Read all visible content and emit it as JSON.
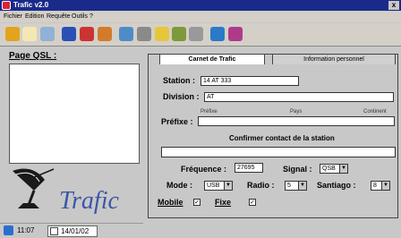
{
  "window": {
    "title": "Trafic v2.0",
    "close_glyph": "x"
  },
  "menu": [
    "Fichier",
    "Edition",
    "Requête",
    "Outils",
    "?"
  ],
  "toolbar": {
    "icons": [
      {
        "name": "pencil-icon",
        "color": "#e2a31d"
      },
      {
        "name": "open-book-icon",
        "color": "#f3e7b5"
      },
      {
        "name": "save-book-icon",
        "color": "#8fb2d6"
      },
      {
        "name": "blue-book-icon",
        "color": "#2a4fb7"
      },
      {
        "name": "book-red-icon",
        "color": "#c33"
      },
      {
        "name": "edit-document-icon",
        "color": "#d47b2a"
      },
      {
        "name": "search-icon",
        "color": "#4f8bc8"
      },
      {
        "name": "printer-icon",
        "color": "#8a8a8a"
      },
      {
        "name": "star-icon",
        "color": "#e8c63b"
      },
      {
        "name": "gear-icon",
        "color": "#7d9a3b"
      },
      {
        "name": "tools-icon",
        "color": "#999"
      },
      {
        "name": "globe-icon",
        "color": "#2a7ac8"
      },
      {
        "name": "satellite-icon",
        "color": "#b03a8a"
      }
    ]
  },
  "left": {
    "qsl_label": "Page QSL :",
    "logo_text": "Trafic"
  },
  "taskbar": {
    "time": "11:07",
    "date": "14/01/02"
  },
  "tabs": {
    "carnet": "Carnet de Trafic",
    "info": "Information personnel"
  },
  "form": {
    "station_label": "Station :",
    "station_value": "14 AT 333",
    "division_label": "Division :",
    "division_value": "AT",
    "prefixe_label": "Préfixe :",
    "sub_prefixe": "Préfixe",
    "sub_pays": "Pays",
    "sub_continent": "Continent",
    "confirm_heading": "Confirmer contact de la station",
    "frequence_label": "Fréquence :",
    "frequence_value": "27695",
    "signal_label": "Signal :",
    "signal_value": "QSB",
    "mode_label": "Mode :",
    "mode_value": "USB",
    "radio_label": "Radio :",
    "radio_value": "5",
    "santiago_label": "Santiago :",
    "santiago_value": "8",
    "mobile_label": "Mobile",
    "fixe_label": "Fixe",
    "check_glyph": "✓",
    "arrow_glyph": "▼"
  }
}
